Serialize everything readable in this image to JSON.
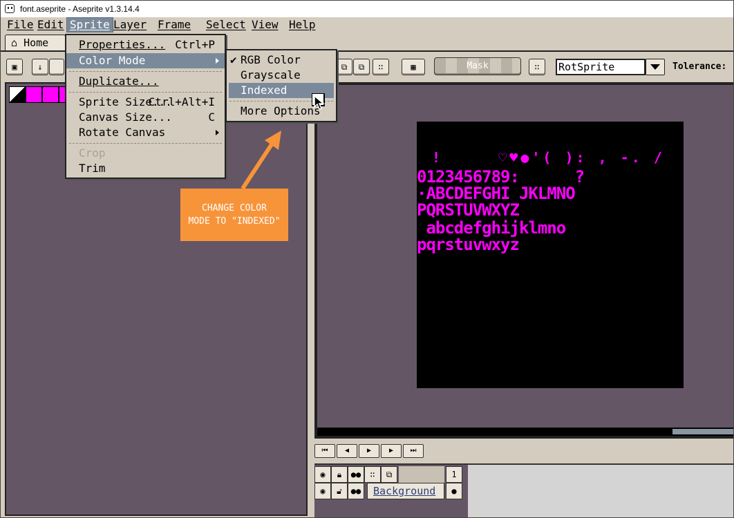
{
  "window": {
    "title": "font.aseprite - Aseprite v1.3.14.4"
  },
  "menubar": {
    "items": [
      "File",
      "Edit",
      "Sprite",
      "Layer",
      "Frame",
      "Select",
      "View",
      "Help"
    ]
  },
  "tabs": {
    "home": "Home"
  },
  "toolbar": {
    "mask_label": "Mask",
    "rotation_value": "RotSprite",
    "tolerance_label": "Tolerance:"
  },
  "sprite_menu": {
    "items": [
      {
        "label": "Properties...",
        "shortcut": "Ctrl+P"
      },
      {
        "label": "Color Mode",
        "shortcut": ""
      },
      {
        "label": "Duplicate...",
        "shortcut": ""
      },
      {
        "label": "Sprite Size...",
        "shortcut": "Ctrl+Alt+I"
      },
      {
        "label": "Canvas Size...",
        "shortcut": "C"
      },
      {
        "label": "Rotate Canvas",
        "shortcut": ""
      },
      {
        "label": "Crop",
        "shortcut": ""
      },
      {
        "label": "Trim",
        "shortcut": ""
      }
    ]
  },
  "color_mode_menu": {
    "items": [
      "RGB Color",
      "Grayscale",
      "Indexed",
      "More Options"
    ],
    "checked": "RGB Color",
    "highlighted": "Indexed"
  },
  "callout": {
    "line1": "CHANGE COLOR",
    "line2": "MODE TO \"INDEXED\""
  },
  "sprite_text": {
    "row1": "!     ♡♥●'( ): , -. /",
    "row2": "0123456789:      ?",
    "row3": "·ABCDEFGHI JKLMNO",
    "row4": "PQRSTUVWXYZ",
    "row5": " abcdefghijklmno",
    "row6": "pqrstuvwxyz"
  },
  "timeline": {
    "layer_name": "Background",
    "frame_number": "1"
  },
  "colors": {
    "accent": "#ff00ff",
    "menu_highlight": "#7a8a9a",
    "callout": "#f7943a",
    "workspace": "#645664"
  }
}
